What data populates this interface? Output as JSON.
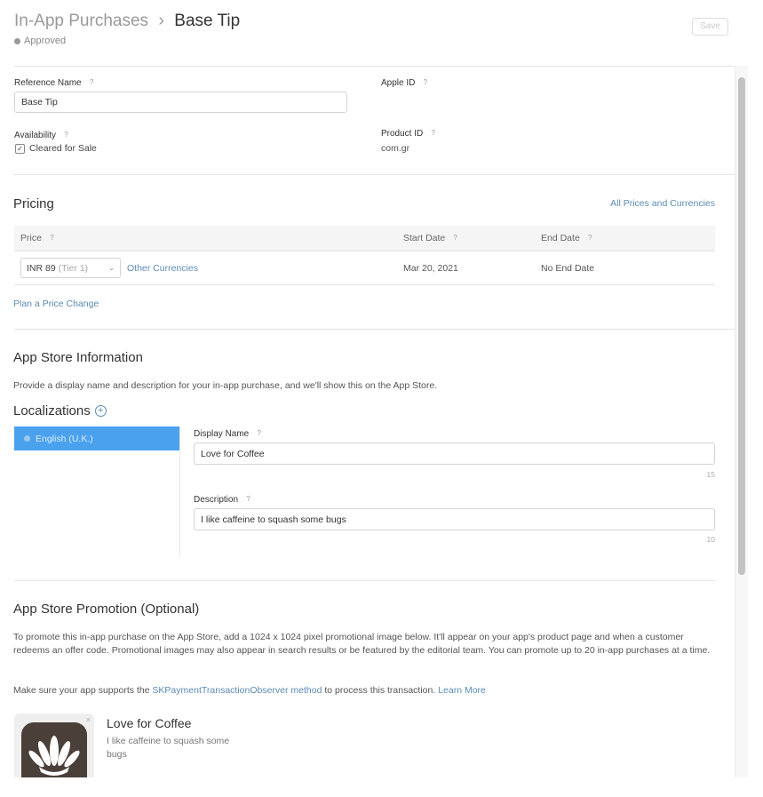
{
  "header": {
    "breadcrumb_parent": "In-App Purchases",
    "breadcrumb_separator": "›",
    "title": "Base Tip",
    "status": "Approved",
    "save_label": "Save"
  },
  "general": {
    "reference_name_label": "Reference Name",
    "reference_name_value": "Base Tip",
    "apple_id_label": "Apple ID",
    "availability_label": "Availability",
    "cleared_for_sale_label": "Cleared for Sale",
    "cleared_for_sale_checked": true,
    "product_id_label": "Product ID",
    "product_id_value": "com.gr"
  },
  "pricing": {
    "title": "Pricing",
    "all_prices_link": "All Prices and Currencies",
    "columns": {
      "price": "Price",
      "start_date": "Start Date",
      "end_date": "End Date"
    },
    "row": {
      "price_value": "INR 89",
      "tier": "(Tier 1)",
      "other_currencies": "Other Currencies",
      "start_date": "Mar 20, 2021",
      "end_date": "No End Date"
    },
    "plan_price_change": "Plan a Price Change"
  },
  "app_store_info": {
    "title": "App Store Information",
    "description": "Provide a display name and description for your in-app purchase, and we'll show this on the App Store.",
    "localizations_label": "Localizations",
    "localization_selected": "English (U.K.)",
    "display_name_label": "Display Name",
    "display_name_value": "Love for Coffee",
    "display_name_count": "15",
    "description_label": "Description",
    "description_value": "I like caffeine to squash some bugs",
    "description_count": "10"
  },
  "promotion": {
    "title": "App Store Promotion (Optional)",
    "text": "To promote this in-app purchase on the App Store, add a 1024 x 1024 pixel promotional image below. It'll appear on your app's product page and when a customer redeems an offer code. Promotional images may also appear in search results or be featured by the editorial team. You can promote up to 20 in-app purchases at a time.",
    "support_prefix": "Make sure your app supports the ",
    "support_link": "SKPaymentTransactionObserver method",
    "support_suffix": " to process this transaction. ",
    "learn_more": "Learn More",
    "preview_title": "Love for Coffee",
    "preview_desc": "I like caffeine to squash some bugs"
  },
  "colors": {
    "accent": "#5b8bb5",
    "selected_row": "#4aa2ef",
    "icon_bg": "#4a4039"
  }
}
